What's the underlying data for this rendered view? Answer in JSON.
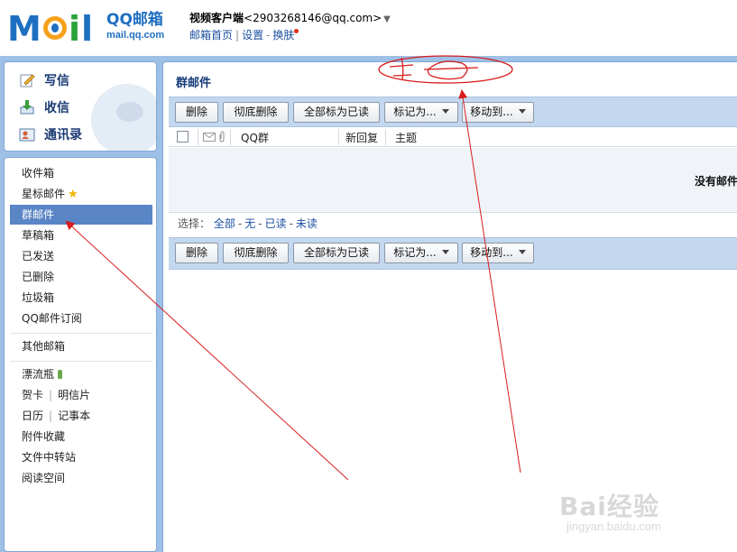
{
  "header": {
    "logo_main": "MOil",
    "logo_brand": "QQ邮箱",
    "logo_url": "mail.qq.com",
    "account_name": "视频客户端",
    "account_email": "<2903268146@qq.com>",
    "links": [
      "邮箱首页",
      "设置",
      "换肤"
    ]
  },
  "compose": {
    "write": "写信",
    "receive": "收信",
    "contacts": "通讯录"
  },
  "folders": {
    "inbox": "收件箱",
    "starred": "星标邮件",
    "group": "群邮件",
    "drafts": "草稿箱",
    "sent": "已发送",
    "deleted": "已删除",
    "junk": "垃圾箱",
    "subscribe": "QQ邮件订阅",
    "other": "其他邮箱",
    "bottle": "漂流瓶",
    "card": "贺卡",
    "postcard": "明信片",
    "calendar": "日历",
    "notes": "记事本",
    "attachments": "附件收藏",
    "transfer": "文件中转站",
    "reading": "阅读空间"
  },
  "main": {
    "title": "群邮件",
    "toolbar": {
      "delete": "删除",
      "perm_delete": "彻底删除",
      "mark_all_read": "全部标为已读",
      "mark_as": "标记为...",
      "move_to": "移动到..."
    },
    "columns": {
      "group": "QQ群",
      "new_reply": "新回复",
      "subject": "主题"
    },
    "empty_message": "没有邮件",
    "select": {
      "label": "选择：",
      "all": "全部",
      "none": "无",
      "read": "已读",
      "unread": "未读"
    }
  },
  "watermark": {
    "brand": "Bai经验",
    "url": "jingyan.baidu.com"
  },
  "colors": {
    "frame_blue": "#9ec0e6",
    "toolbar_blue": "#c3d7ee",
    "selected_folder": "#5a85c6",
    "link_blue": "#1b4fa0",
    "annotation_red": "#d81b1b"
  },
  "icons": [
    "write-icon",
    "receive-icon",
    "contacts-icon",
    "star-icon",
    "bottle-icon",
    "envelope-icon",
    "attachment-icon",
    "chevron-down-icon"
  ]
}
